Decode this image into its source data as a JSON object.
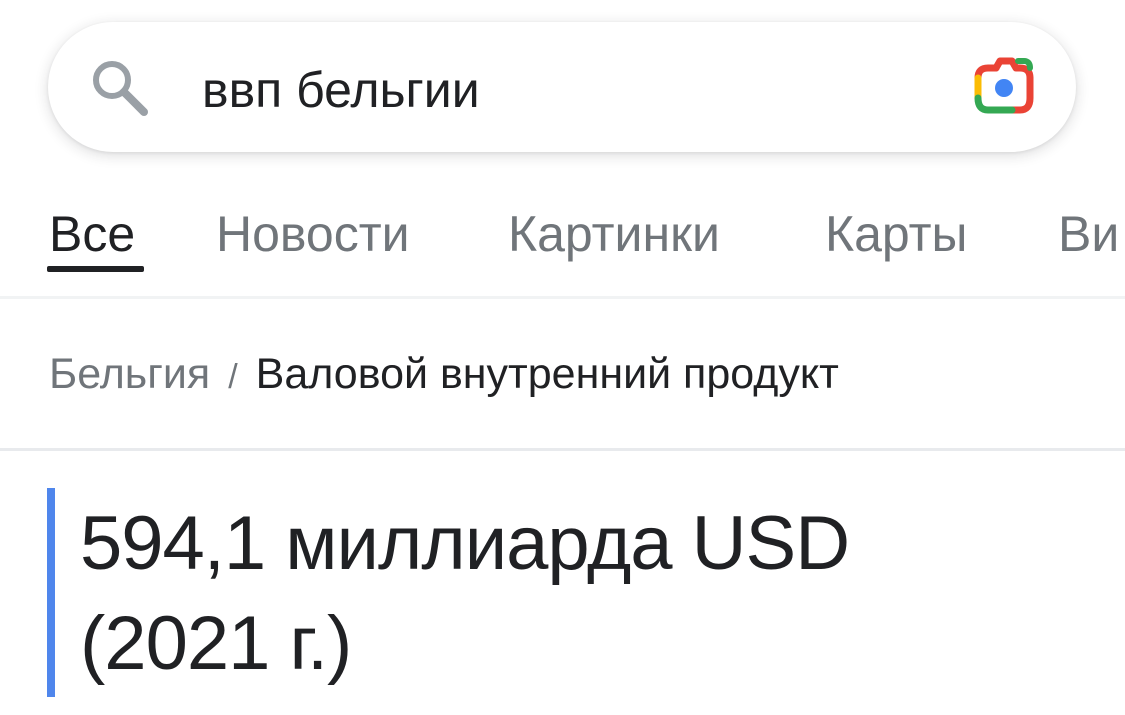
{
  "search": {
    "query": "ввп бельгии"
  },
  "tabs": [
    {
      "label": "Все",
      "active": true
    },
    {
      "label": "Новости",
      "active": false
    },
    {
      "label": "Картинки",
      "active": false
    },
    {
      "label": "Карты",
      "active": false
    },
    {
      "label": "Ви",
      "active": false
    }
  ],
  "breadcrumb": {
    "parent": "Бельгия",
    "separator": "/",
    "current": "Валовой внутренний продукт"
  },
  "answer": {
    "value_line": "594,1 миллиарда USD",
    "year_line": "(2021 г.)"
  },
  "colors": {
    "accent_bar": "#4f86ec",
    "active_tab": "#202124",
    "inactive_tab": "#70757a"
  },
  "icons": {
    "search": "search-icon",
    "lens": "google-lens-icon"
  }
}
